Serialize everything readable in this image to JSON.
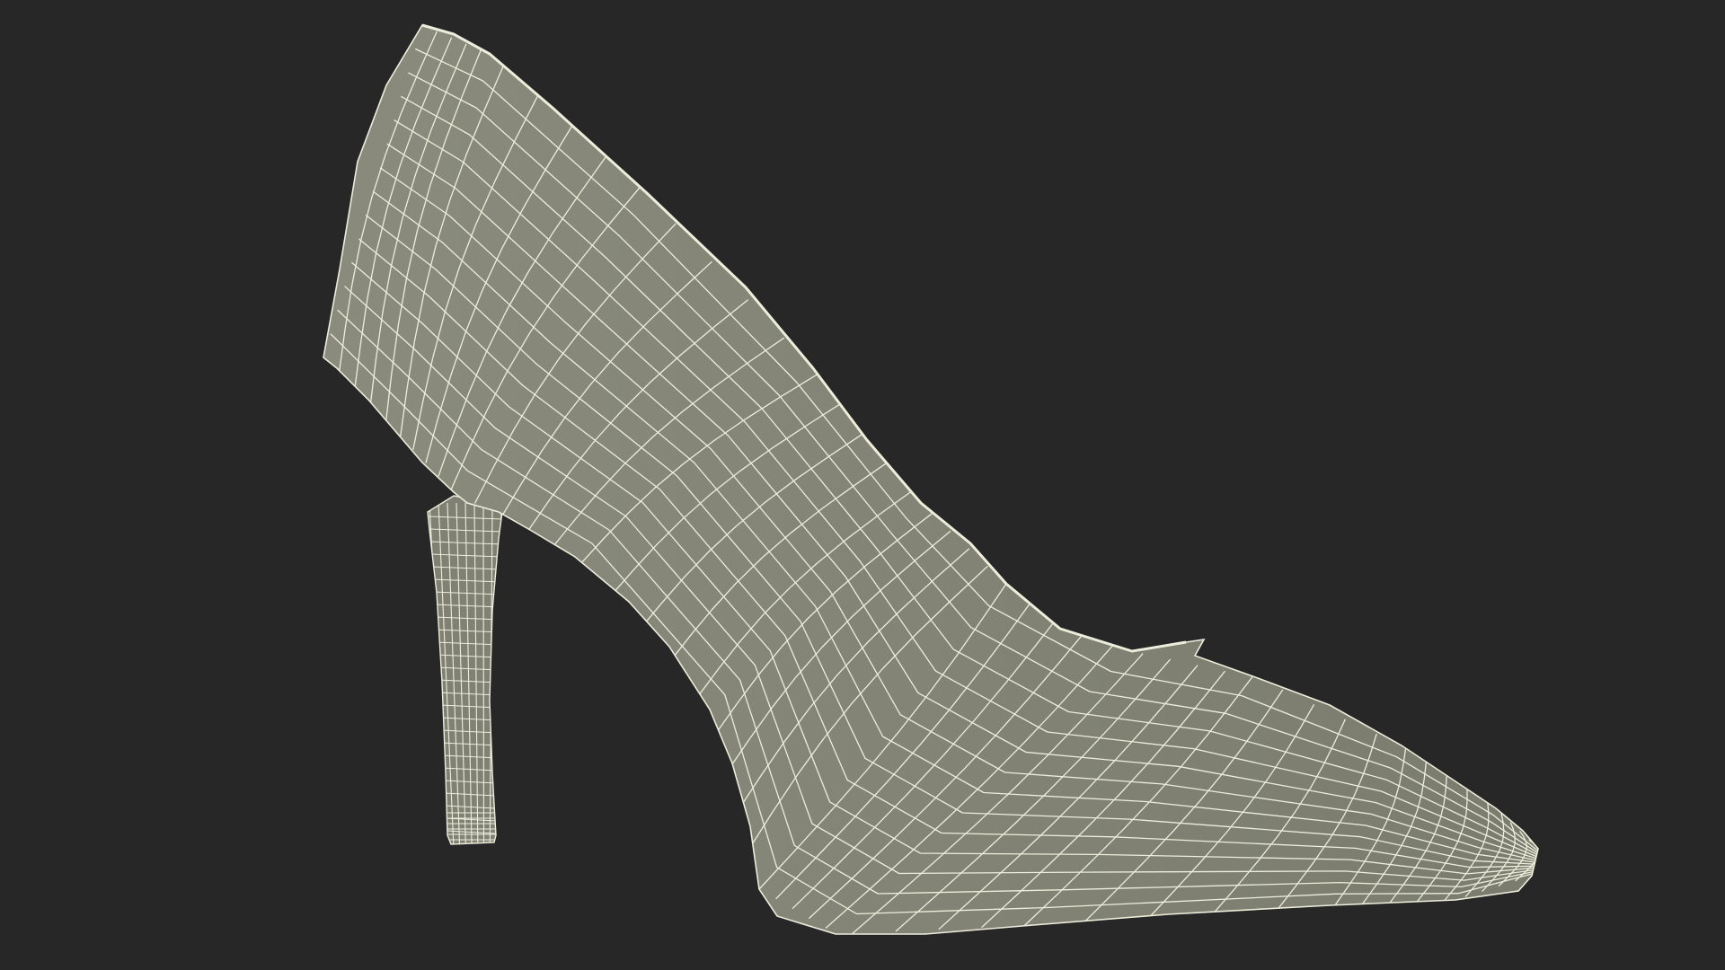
{
  "scene": {
    "subject": "high-heel-pump-wireframe",
    "colors": {
      "background": "#272727",
      "shell_fill": "#7b7c6e",
      "shell_fill_light": "#8a8b7c",
      "inner_fill": "#2e302a",
      "inner_fill_mid": "#3e4038",
      "wire": "#ecedda",
      "wire_inner": "#8d8f80",
      "heel_fill": "#808173"
    }
  }
}
